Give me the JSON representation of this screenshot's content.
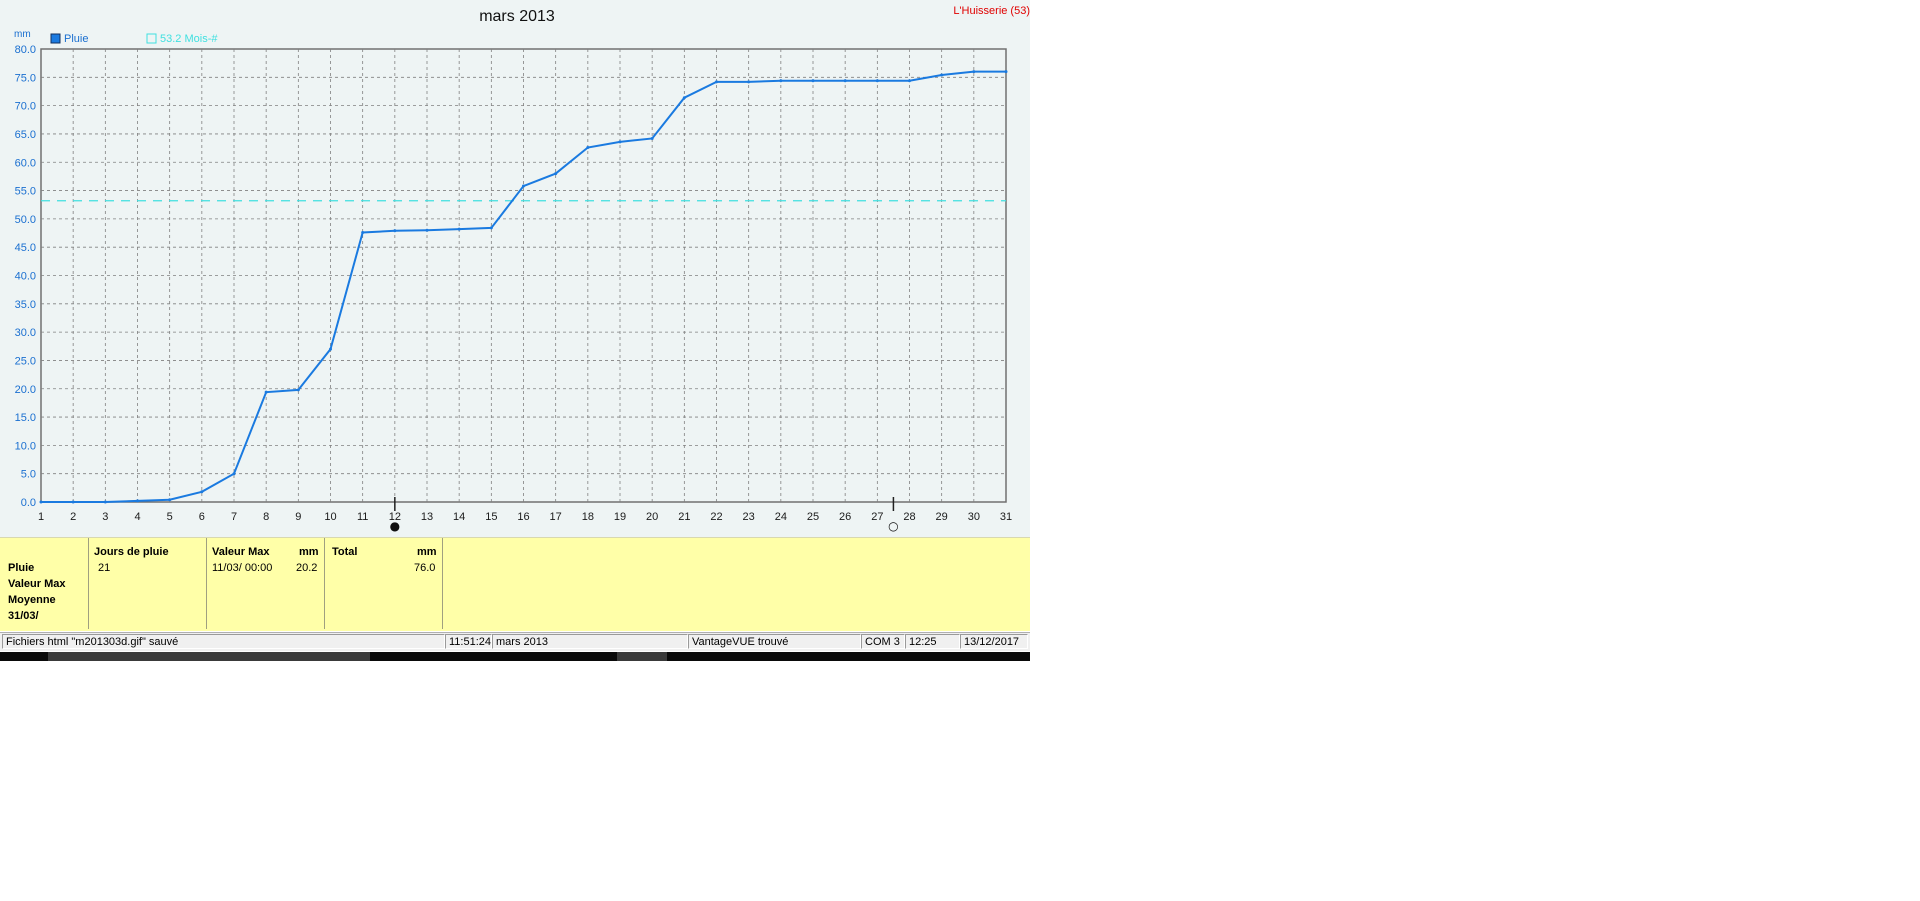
{
  "window": {
    "station": "L'Huisserie (53)"
  },
  "chart_data": {
    "type": "line",
    "title": "mars 2013",
    "ylabel": "mm",
    "ylim": [
      0,
      80
    ],
    "yticks": [
      "0.0",
      "5.0",
      "10.0",
      "15.0",
      "20.0",
      "25.0",
      "30.0",
      "35.0",
      "40.0",
      "45.0",
      "50.0",
      "55.0",
      "60.0",
      "65.0",
      "70.0",
      "75.0",
      "80.0"
    ],
    "x": [
      1,
      2,
      3,
      4,
      5,
      6,
      7,
      8,
      9,
      10,
      11,
      12,
      13,
      14,
      15,
      16,
      17,
      18,
      19,
      20,
      21,
      22,
      23,
      24,
      25,
      26,
      27,
      28,
      29,
      30,
      31
    ],
    "grid": true,
    "legend": "top-left",
    "series": [
      {
        "name": "Pluie",
        "color": "#1a7ae0",
        "values": [
          0,
          0,
          0,
          0.2,
          0.4,
          1.8,
          5,
          19.4,
          19.8,
          27,
          47.6,
          47.9,
          48,
          48.2,
          48.4,
          55.8,
          58,
          62.6,
          63.6,
          64.2,
          71.4,
          74.2,
          74.2,
          74.4,
          74.4,
          74.4,
          74.4,
          74.4,
          75.4,
          76,
          76
        ]
      },
      {
        "name": "53.2 Mois-#",
        "color": "#40e0e0",
        "constant": 53.2,
        "style": "dashed"
      }
    ],
    "markers": [
      {
        "x": 12,
        "symbol": "●"
      },
      {
        "x": 27.5,
        "symbol": "○"
      }
    ]
  },
  "stats": {
    "rows": [
      "Pluie",
      "Valeur Max",
      "Moyenne",
      "31/03/"
    ],
    "jours": {
      "title": "Jours de pluie",
      "value": "21"
    },
    "valmax": {
      "title": "Valeur Max",
      "unit": "mm",
      "date": "11/03/  00:00",
      "value": "20.2"
    },
    "total": {
      "title": "Total",
      "unit": "mm",
      "value": "76.0"
    }
  },
  "status": {
    "message": "Fichiers html  \"m201303d.gif\"  sauvé",
    "time": "11:51:24",
    "period": "mars 2013",
    "device": "VantageVUE trouvé",
    "port": "COM 3",
    "clock": "12:25",
    "date": "13/12/2017"
  }
}
